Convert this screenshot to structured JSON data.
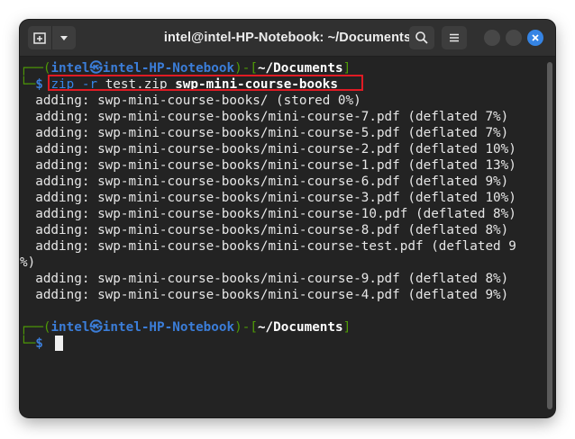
{
  "window": {
    "title": "intel@intel-HP-Notebook: ~/Documents"
  },
  "toolbar": {
    "new_tab_icon": "new-tab-icon",
    "menu_dropdown_icon": "chevron-down-icon",
    "search_icon": "search-icon",
    "hamburger_icon": "hamburger-menu-icon",
    "close_icon": "close-icon"
  },
  "prompt1": {
    "corner_top": "┌──(",
    "user": "intel",
    "at": "㉿",
    "host": "intel-HP-Notebook",
    "mid": ")-[",
    "dir": "~/Documents",
    "end": "]",
    "corner_bottom": "└─",
    "dollar": "$",
    "cmd": "zip",
    "flag": "-r",
    "arg1": "test.zip",
    "arg2": "swp-mini-course-books"
  },
  "output": [
    "  adding: swp-mini-course-books/ (stored 0%)",
    "  adding: swp-mini-course-books/mini-course-7.pdf (deflated 7%)",
    "  adding: swp-mini-course-books/mini-course-5.pdf (deflated 7%)",
    "  adding: swp-mini-course-books/mini-course-2.pdf (deflated 10%)",
    "  adding: swp-mini-course-books/mini-course-1.pdf (deflated 13%)",
    "  adding: swp-mini-course-books/mini-course-6.pdf (deflated 9%)",
    "  adding: swp-mini-course-books/mini-course-3.pdf (deflated 10%)",
    "  adding: swp-mini-course-books/mini-course-10.pdf (deflated 8%)",
    "  adding: swp-mini-course-books/mini-course-8.pdf (deflated 8%)",
    "  adding: swp-mini-course-books/mini-course-test.pdf (deflated 9",
    "%)",
    "  adding: swp-mini-course-books/mini-course-9.pdf (deflated 8%)",
    "  adding: swp-mini-course-books/mini-course-4.pdf (deflated 9%)"
  ],
  "prompt2": {
    "corner_top": "┌──(",
    "user": "intel",
    "at": "㉿",
    "host": "intel-HP-Notebook",
    "mid": ")-[",
    "dir": "~/Documents",
    "end": "]",
    "corner_bottom": "└─",
    "dollar": "$"
  },
  "colors": {
    "prompt_green": "#4e9a06",
    "prompt_blue": "#3b7dd8",
    "highlight_red": "#e01b24",
    "close_blue": "#3584e4"
  }
}
